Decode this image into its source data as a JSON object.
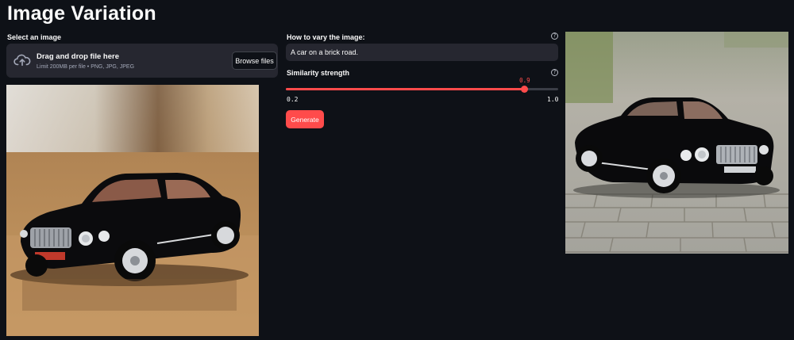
{
  "app": {
    "title": "Image Variation"
  },
  "uploader": {
    "label": "Select an image",
    "dropzone_title": "Drag and drop file here",
    "dropzone_limit": "Limit 200MB per file • PNG, JPG, JPEG",
    "browse_label": "Browse files",
    "icon": "upload-cloud-icon"
  },
  "prompt": {
    "label": "How to vary the image:",
    "value": "A car on a brick road.",
    "help_icon": "question-circle-icon"
  },
  "similarity": {
    "label": "Similarity strength",
    "value": 0.9,
    "value_text": "0.9",
    "min": 0.2,
    "min_text": "0.2",
    "max": 1.0,
    "max_text": "1.0",
    "help_icon": "question-circle-icon"
  },
  "generate": {
    "label": "Generate"
  },
  "images": {
    "input": "black toy car on wooden table",
    "output": "black toy car on brick road"
  },
  "colors": {
    "background": "#0e1117",
    "accent": "#ff4b4b",
    "widget_bg": "#262730"
  }
}
